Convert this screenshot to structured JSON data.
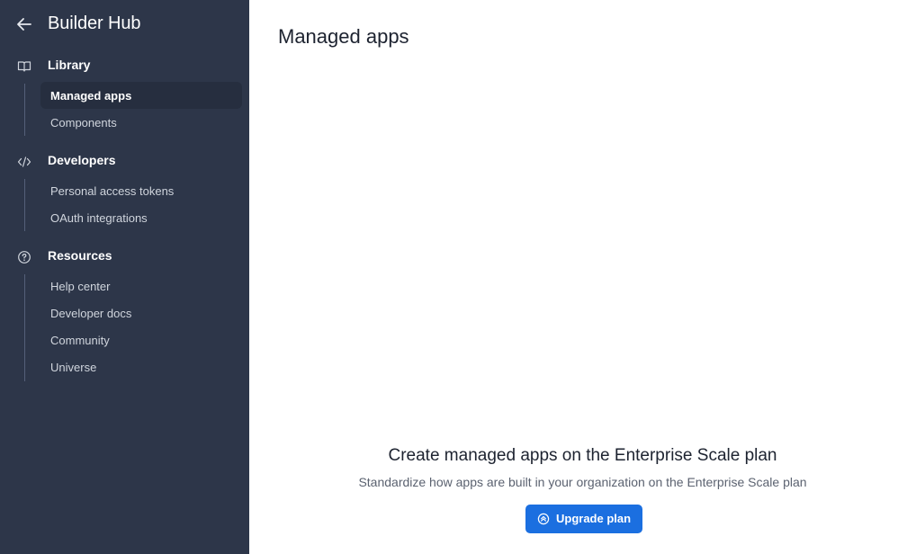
{
  "sidebar": {
    "title": "Builder Hub",
    "sections": [
      {
        "label": "Library",
        "icon": "book-icon",
        "items": [
          {
            "label": "Managed apps",
            "active": true
          },
          {
            "label": "Components",
            "active": false
          }
        ]
      },
      {
        "label": "Developers",
        "icon": "code-icon",
        "items": [
          {
            "label": "Personal access tokens",
            "active": false
          },
          {
            "label": "OAuth integrations",
            "active": false
          }
        ]
      },
      {
        "label": "Resources",
        "icon": "help-circle-icon",
        "items": [
          {
            "label": "Help center",
            "active": false
          },
          {
            "label": "Developer docs",
            "active": false
          },
          {
            "label": "Community",
            "active": false
          },
          {
            "label": "Universe",
            "active": false
          }
        ]
      }
    ]
  },
  "main": {
    "page_title": "Managed apps",
    "empty_state": {
      "title": "Create managed apps on the Enterprise Scale plan",
      "subtitle": "Standardize how apps are built in your organization on the Enterprise Scale plan",
      "button_label": "Upgrade plan",
      "button_icon": "upgrade-icon"
    }
  },
  "colors": {
    "sidebar_bg": "#2d3649",
    "active_item_bg": "#262e3f",
    "primary_button": "#1b6fe0"
  }
}
